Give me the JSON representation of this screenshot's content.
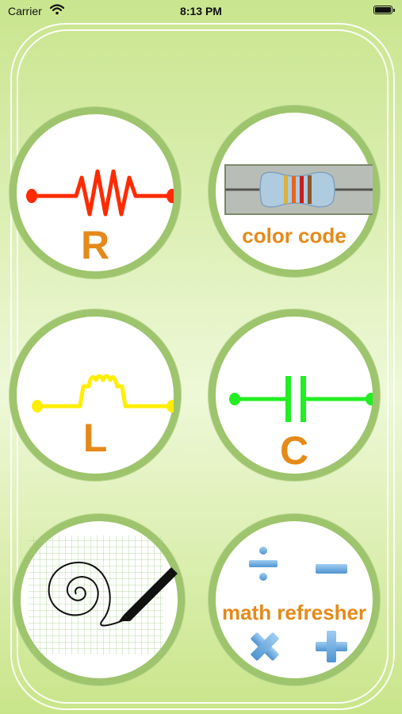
{
  "status": {
    "carrier": "Carrier",
    "time": "8:13 PM"
  },
  "menu": {
    "resistor": {
      "label": "R"
    },
    "color_code": {
      "label": "color code"
    },
    "inductor": {
      "label": "L"
    },
    "capacitor": {
      "label": "C"
    },
    "graph": {
      "label": ""
    },
    "math": {
      "label": "math refresher",
      "symbols": [
        "÷",
        "−",
        "×",
        "+"
      ]
    }
  },
  "colors": {
    "resistor_trace": "#ff2a00",
    "inductor_trace": "#ffee00",
    "capacitor_trace": "#22ee22",
    "label_orange": "#e48a1a",
    "math_symbols": "#6aa8dc",
    "ring": "#9ec46d"
  }
}
